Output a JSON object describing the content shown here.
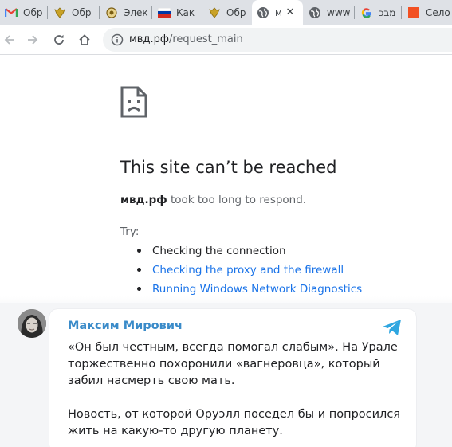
{
  "tabs": [
    {
      "title": "Обр",
      "icon": "gmail-icon"
    },
    {
      "title": "Обр",
      "icon": "coat-of-arms-icon"
    },
    {
      "title": "Элек",
      "icon": "emblem-icon"
    },
    {
      "title": "Как",
      "icon": "russia-flag-icon"
    },
    {
      "title": "Обр",
      "icon": "coat-of-arms-icon"
    },
    {
      "title": "м",
      "icon": "globe-icon",
      "active": true,
      "close": "✕"
    },
    {
      "title": "www",
      "icon": "globe-icon"
    },
    {
      "title": "מבכ",
      "icon": "google-icon"
    },
    {
      "title": "Село",
      "icon": "orange-square-icon"
    }
  ],
  "address_bar": {
    "domain": "мвд.рф",
    "path": "/request_main"
  },
  "error": {
    "title": "This site can’t be reached",
    "host": "мвд.рф",
    "message": "took too long to respond.",
    "try_label": "Try:",
    "suggestions": [
      {
        "text": "Checking the connection",
        "link": false
      },
      {
        "text": "Checking the proxy and the firewall",
        "link": true
      },
      {
        "text": "Running Windows Network Diagnostics",
        "link": true
      }
    ]
  },
  "post": {
    "author": "Максим Мирович",
    "lines": [
      "«Он был честным, всегда помогал слабым». На Урале",
      "торжественно похоронили «вагнеровца», который",
      "забил насмерть свою мать.",
      "",
      "Новость, от которой Оруэлл поседел бы и попросился",
      "жить на какую-то другую планету."
    ]
  },
  "colors": {
    "tab_strip": "#dee1e6",
    "link": "#1a73e8",
    "author": "#3a8bc9",
    "telegram": "#2ea6e0"
  }
}
